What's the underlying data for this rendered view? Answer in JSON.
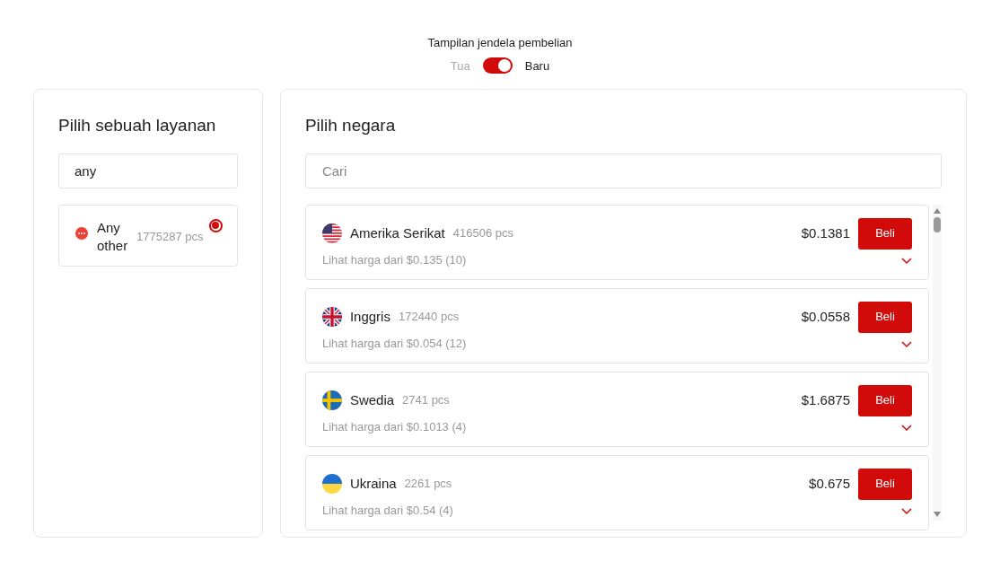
{
  "view_toggle": {
    "title": "Tampilan jendela pembelian",
    "off_label": "Tua",
    "on_label": "Baru",
    "on": true
  },
  "services": {
    "title": "Pilih sebuah layanan",
    "search": {
      "value": "any"
    },
    "items": [
      {
        "name": "Any other",
        "count": "1775287 pcs",
        "selected": true
      }
    ]
  },
  "countries": {
    "title": "Pilih negara",
    "search": {
      "placeholder": "Cari"
    },
    "items": [
      {
        "kind": "us",
        "name": "Amerika Serikat",
        "count": "416506 pcs",
        "price": "$0.1381",
        "button": "Beli",
        "from": "Lihat harga dari $0.135 (10)",
        "expanded": false
      },
      {
        "kind": "gb",
        "name": "Inggris",
        "count": "172440 pcs",
        "price": "$0.0558",
        "button": "Beli",
        "from": "Lihat harga dari $0.054 (12)",
        "expanded": false
      },
      {
        "kind": "se",
        "name": "Swedia",
        "count": "2741 pcs",
        "price": "$1.6875",
        "button": "Beli",
        "from": "Lihat harga dari $0.1013 (4)",
        "expanded": false
      },
      {
        "kind": "ua",
        "name": "Ukraina",
        "count": "2261 pcs",
        "price": "$0.675",
        "button": "Beli",
        "from": "Lihat harga dari $0.54 (4)",
        "expanded": false
      }
    ]
  }
}
